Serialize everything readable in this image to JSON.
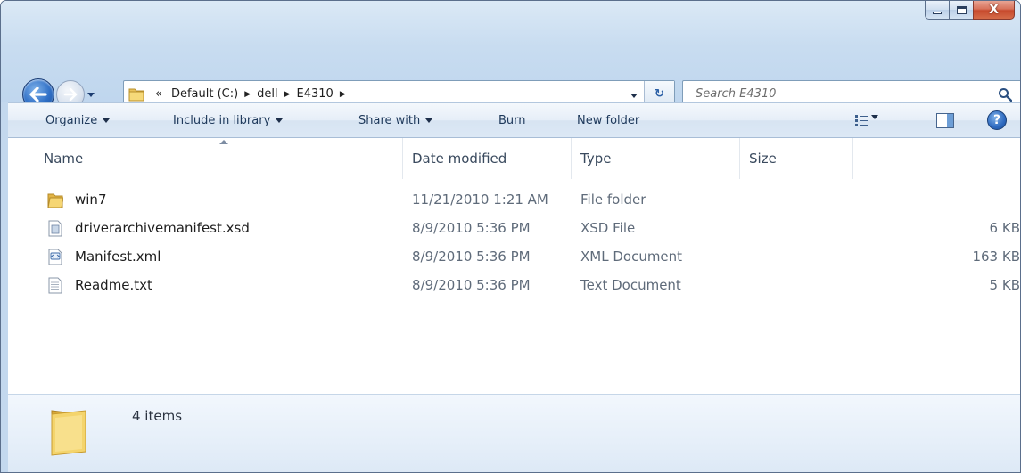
{
  "window": {
    "caption_buttons": {
      "minimize_icon": "minimize-icon",
      "maximize_icon": "maximize-icon",
      "close_glyph": "X"
    }
  },
  "navigation": {
    "back_icon": "back-arrow-icon",
    "forward_icon": "forward-arrow-icon",
    "recent_icon": "chevron-down-icon"
  },
  "address_bar": {
    "overflow_glyph": "«",
    "crumbs": [
      "Default (C:)",
      "dell",
      "E4310"
    ],
    "separator_glyph": "▶",
    "refresh_glyph": "↻"
  },
  "search": {
    "placeholder": "Search E4310"
  },
  "command_bar": {
    "organize_label": "Organize",
    "include_label": "Include in library",
    "share_label": "Share with",
    "burn_label": "Burn",
    "new_folder_label": "New folder",
    "help_glyph": "?"
  },
  "columns": {
    "name": "Name",
    "date": "Date modified",
    "type": "Type",
    "size": "Size"
  },
  "files": [
    {
      "name": "win7",
      "date": "11/21/2010 1:21 AM",
      "type": "File folder",
      "size": "",
      "icon": "folder-icon"
    },
    {
      "name": "driverarchivemanifest.xsd",
      "date": "8/9/2010 5:36 PM",
      "type": "XSD File",
      "size": "6 KB",
      "icon": "xsd-file-icon"
    },
    {
      "name": "Manifest.xml",
      "date": "8/9/2010 5:36 PM",
      "type": "XML Document",
      "size": "163 KB",
      "icon": "xml-file-icon"
    },
    {
      "name": "Readme.txt",
      "date": "8/9/2010 5:36 PM",
      "type": "Text Document",
      "size": "5 KB",
      "icon": "text-file-icon"
    }
  ],
  "details": {
    "item_count": "4 items"
  },
  "colors": {
    "frame": "#c8dcf0",
    "accent": "#2f6fc6",
    "close_red": "#c74a2d"
  }
}
